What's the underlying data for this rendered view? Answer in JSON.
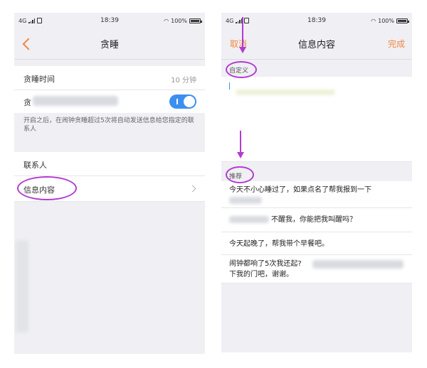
{
  "left_screen": {
    "status": {
      "network": "4G",
      "time": "18:39",
      "battery": "100%"
    },
    "title": "贪睡",
    "snooze_time": {
      "label": "贪睡时间",
      "value": "10 分钟"
    },
    "auto_send": {
      "label_visible": "贪",
      "hint": "开启之后，在闹钟贪睡超过5次将自动发送信息给您指定的联系人"
    },
    "contacts_label": "联系人",
    "message_content_label": "信息内容"
  },
  "right_screen": {
    "status": {
      "network": "4G",
      "time": "18:39",
      "battery": "100%"
    },
    "title": "信息内容",
    "cancel": "取消",
    "done": "完成",
    "custom_label": "自定义",
    "recommend_label": "推荐",
    "recommendations": [
      "今天不小心睡过了，如果点名了帮我报到一下",
      "不醒我，你能把我叫醒吗？",
      "今天起晚了，帮我带个早餐吧。",
      "闹钟都响了5次我还起?",
      "下我的门吧，谢谢。"
    ]
  },
  "colors": {
    "accent": "#f08a3e",
    "toggle_on": "#3b8ff0",
    "annotation": "#b33bd1"
  }
}
